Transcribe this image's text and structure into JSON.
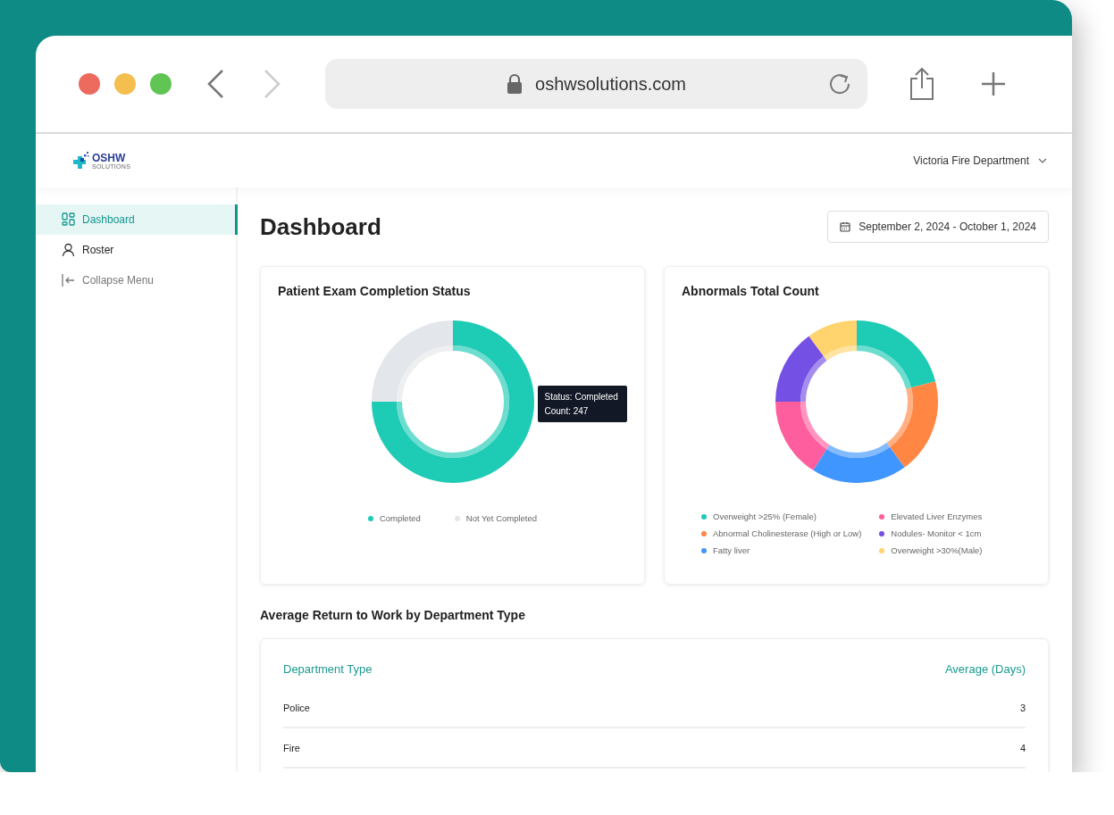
{
  "browser": {
    "url": "oshwsolutions.com"
  },
  "header": {
    "logo": {
      "name": "OSHW",
      "tagline": "SOLUTIONS"
    },
    "organization": "Victoria Fire Department"
  },
  "sidebar": {
    "items": [
      {
        "label": "Dashboard",
        "selected": true
      },
      {
        "label": "Roster",
        "selected": false
      }
    ],
    "collapse_button": {
      "label": "Collapse Menu"
    }
  },
  "page": {
    "title": "Dashboard",
    "date_range": "September 2, 2024 - October 1, 2024"
  },
  "cards": [
    {
      "title": "Patient Exam Completion Status",
      "tooltip": {
        "lines": [
          "Status: Completed",
          "Count: 247"
        ]
      },
      "legend": [
        {
          "label": "Completed",
          "color": "#1ecbb5"
        },
        {
          "label": "Not Yet Completed",
          "color": "#e3e6ea"
        }
      ]
    },
    {
      "title": "Abnormals Total Count",
      "legend": [
        {
          "label": "Overweight >25% (Female)",
          "color": "#1ecbb5"
        },
        {
          "label": "Abnormal Cholinesterase (High or Low)",
          "color": "#ff8743"
        },
        {
          "label": "Fatty liver",
          "color": "#4096ff"
        },
        {
          "label": "Elevated Liver Enzymes",
          "color": "#ff5e9e"
        },
        {
          "label": "Nodules- Monitor < 1cm",
          "color": "#7450e5"
        },
        {
          "label": "Overweight >30%(Male)",
          "color": "#ffd46e"
        }
      ]
    }
  ],
  "return_to_work": {
    "title": "Average Return to Work by Department Type",
    "columns": [
      "Department Type",
      "Average (Days)"
    ],
    "rows": [
      [
        "Police",
        "3"
      ],
      [
        "Fire",
        "4"
      ]
    ]
  }
}
